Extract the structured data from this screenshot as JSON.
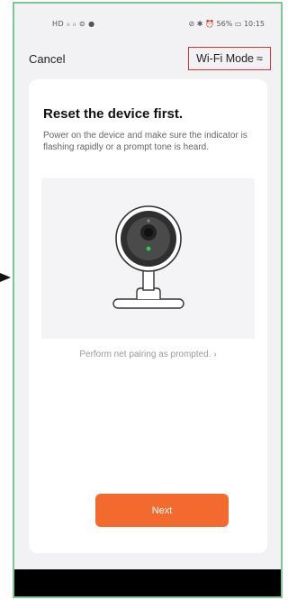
{
  "status_bar": {
    "left_icons": "HD ᵢₗ ᵢₗ ⊜ ●",
    "right_text": "⊘ ✱ ⏰ 56% ▭ 10:15"
  },
  "topbar": {
    "cancel_label": "Cancel",
    "wifi_mode_label": "Wi-Fi Mode",
    "wifi_mode_icon": "≈"
  },
  "card": {
    "title": "Reset the device first.",
    "description": "Power on the device and make sure the indicator is flashing rapidly or a prompt tone is heard.",
    "illustration_icon": "security-camera-illustration",
    "perform_link": "Perform net pairing as prompted.",
    "perform_chevron": "›",
    "next_label": "Next"
  },
  "colors": {
    "accent": "#f26a2e",
    "highlight_border": "#dd3333",
    "frame_border": "#7fc79a"
  }
}
